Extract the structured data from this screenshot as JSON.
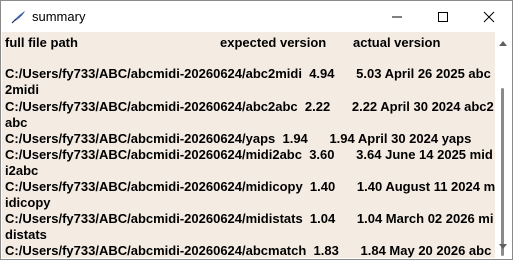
{
  "window": {
    "title": "summary"
  },
  "header": {
    "path": "full file path",
    "expected": "expected version",
    "actual": "actual version"
  },
  "lines": [
    "C:/Users/fy733/ABC/abcmidi-20260624/abc2midi  4.94      5.03 April 26 2025 abc",
    "2midi",
    "C:/Users/fy733/ABC/abcmidi-20260624/abc2abc  2.22      2.22 April 30 2024 abc2",
    "abc",
    "C:/Users/fy733/ABC/abcmidi-20260624/yaps  1.94      1.94 April 30 2024 yaps",
    "C:/Users/fy733/ABC/abcmidi-20260624/midi2abc  3.60      3.64 June 14 2025 mid",
    "i2abc",
    "C:/Users/fy733/ABC/abcmidi-20260624/midicopy  1.40      1.40 August 11 2024 m",
    "idicopy",
    "C:/Users/fy733/ABC/abcmidi-20260624/midistats  1.04      1.04 March 02 2026 mi",
    "distats",
    "C:/Users/fy733/ABC/abcmidi-20260624/abcmatch  1.83      1.84 May 20 2026 abc"
  ]
}
